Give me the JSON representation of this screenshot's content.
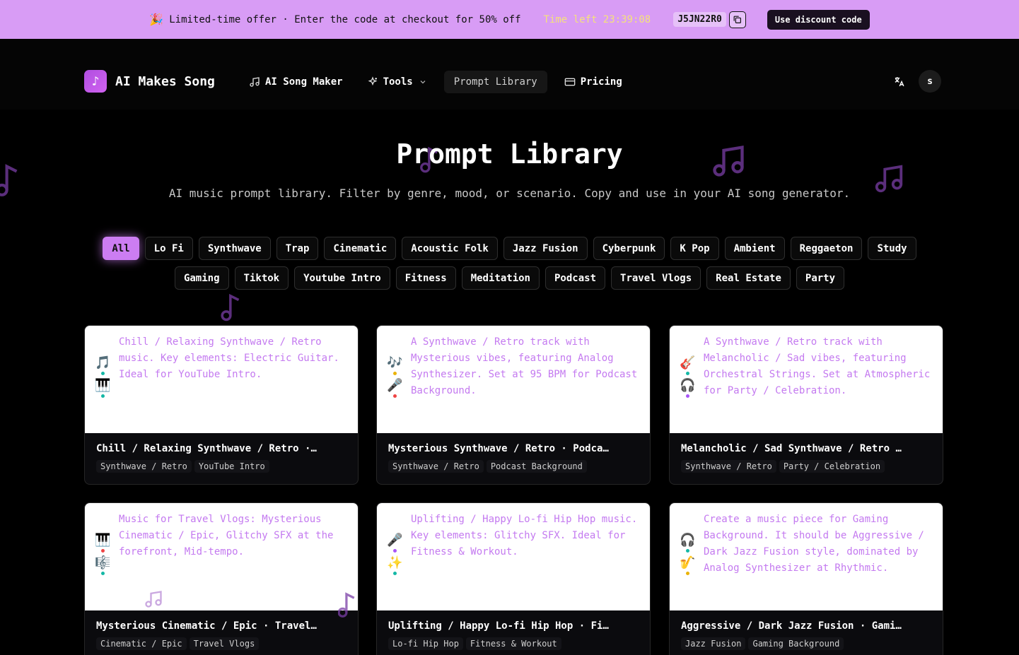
{
  "promo": {
    "emoji": "🎉",
    "offer_text": "Limited-time offer · Enter the code at checkout for 50% off",
    "timer_text": "Time left 23:39:08",
    "code": "J5JN22R0",
    "use_button": "Use discount code"
  },
  "header": {
    "logo_glyph": "♪",
    "logo_text": "AI Makes Song",
    "nav": [
      {
        "label": "AI Song Maker"
      },
      {
        "label": "Tools"
      },
      {
        "label": "Prompt Library"
      },
      {
        "label": "Pricing"
      }
    ],
    "avatar_letter": "s"
  },
  "hero": {
    "title": "Prompt Library",
    "subtitle": "AI music prompt library. Filter by genre, mood, or scenario. Copy and use in your AI song generator."
  },
  "filters": {
    "row1": [
      "All",
      "Lo Fi",
      "Synthwave",
      "Trap",
      "Cinematic",
      "Acoustic Folk",
      "Jazz Fusion",
      "Cyberpunk",
      "K Pop",
      "Ambient",
      "Reggaeton",
      "Study"
    ],
    "row2": [
      "Gaming",
      "Tiktok",
      "Youtube Intro",
      "Fitness",
      "Meditation",
      "Podcast",
      "Travel Vlogs",
      "Real Estate",
      "Party"
    ]
  },
  "cards": [
    {
      "desc": "Chill / Relaxing Synthwave / Retro music. Key elements: Electric Guitar. Ideal for YouTube Intro.",
      "icons": [
        {
          "emoji": "🎵",
          "dot": "#14b8a6"
        },
        {
          "emoji": "🎹",
          "dot": "#14b8a6"
        }
      ],
      "title": "Chill / Relaxing Synthwave / Retro · YouTube Intro",
      "tags": [
        "Synthwave / Retro",
        "YouTube Intro"
      ]
    },
    {
      "desc": "A Synthwave / Retro track with Mysterious vibes, featuring Analog Synthesizer. Set at 95 BPM for Podcast Background.",
      "icons": [
        {
          "emoji": "🎶",
          "dot": "#eab308"
        },
        {
          "emoji": "🎤",
          "dot": "#ef4444"
        }
      ],
      "title": "Mysterious Synthwave / Retro · Podcast Background",
      "tags": [
        "Synthwave / Retro",
        "Podcast Background"
      ]
    },
    {
      "desc": "A Synthwave / Retro track with Melancholic / Sad vibes, featuring Orchestral Strings. Set at Atmospheric for Party / Celebration.",
      "icons": [
        {
          "emoji": "🎸",
          "dot": "#14b8a6"
        },
        {
          "emoji": "🎧",
          "dot": "#a855f7"
        }
      ],
      "title": "Melancholic / Sad Synthwave / Retro · Party / Celebration",
      "tags": [
        "Synthwave / Retro",
        "Party / Celebration"
      ]
    },
    {
      "desc": "Music for Travel Vlogs: Mysterious Cinematic / Epic, Glitchy SFX at the forefront, Mid-tempo.",
      "icons": [
        {
          "emoji": "🎹",
          "dot": "#ef4444"
        },
        {
          "emoji": "🎼",
          "dot": "#14b8a6"
        }
      ],
      "title": "Mysterious Cinematic / Epic · Travel Vlogs",
      "tags": [
        "Cinematic / Epic",
        "Travel Vlogs"
      ]
    },
    {
      "desc": "Uplifting / Happy Lo-fi Hip Hop music. Key elements: Glitchy SFX. Ideal for Fitness & Workout.",
      "icons": [
        {
          "emoji": "🎤",
          "dot": "#a855f7"
        },
        {
          "emoji": "✨",
          "dot": "#14b8a6"
        }
      ],
      "title": "Uplifting / Happy Lo-fi Hip Hop · Fitness & Workout",
      "tags": [
        "Lo-fi Hip Hop",
        "Fitness & Workout"
      ]
    },
    {
      "desc": "Create a music piece for Gaming Background. It should be Aggressive / Dark Jazz Fusion style, dominated by Analog Synthesizer at Rhythmic.",
      "icons": [
        {
          "emoji": "🎧",
          "dot": "#14b8a6"
        },
        {
          "emoji": "🎷",
          "dot": "#eab308"
        }
      ],
      "title": "Aggressive / Dark Jazz Fusion · Gaming Background",
      "tags": [
        "Jazz Fusion",
        "Gaming Background"
      ]
    }
  ]
}
